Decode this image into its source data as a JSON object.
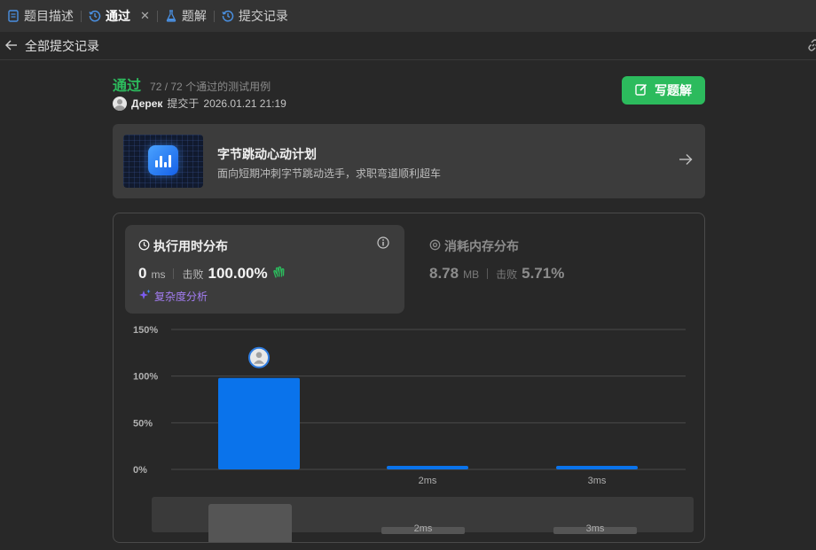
{
  "tabs": [
    {
      "label": "题目描述",
      "icon": "document-icon",
      "active": false
    },
    {
      "label": "通过",
      "icon": "history-icon",
      "active": true
    },
    {
      "label": "题解",
      "icon": "flask-icon",
      "active": false
    },
    {
      "label": "提交记录",
      "icon": "history-icon",
      "active": false
    }
  ],
  "subheader": {
    "back_label": "全部提交记录"
  },
  "submission": {
    "status": "通过",
    "tests_passed": "72 / 72",
    "tests_label": "个通过的测试用例",
    "user": "Дерек",
    "submitted_prefix": "提交于",
    "timestamp": "2026.01.21 21:19",
    "write_solution_label": "写题解"
  },
  "banner": {
    "title": "字节跳动心动计划",
    "subtitle": "面向短期冲刺字节跳动选手，求职弯道顺利超车"
  },
  "runtime": {
    "title": "执行用时分布",
    "value": "0",
    "unit": "ms",
    "beats_label": "击败",
    "beats": "100.00%",
    "complexity_label": "复杂度分析"
  },
  "memory": {
    "title": "消耗内存分布",
    "value": "8.78",
    "unit": "MB",
    "beats_label": "击败",
    "beats": "5.71%"
  },
  "colors": {
    "accent_green": "#2cbb5d",
    "bar_blue": "#0a73eb",
    "purple": "#a37df2"
  },
  "chart_data": {
    "type": "bar",
    "categories": [
      "0ms",
      "2ms",
      "3ms"
    ],
    "values": [
      98,
      3,
      3
    ],
    "visible_x_labels": [
      "",
      "2ms",
      "3ms"
    ],
    "y_ticks": [
      "150%",
      "100%",
      "50%",
      "0%"
    ],
    "ylim": [
      0,
      150
    ],
    "highlight_index": 0,
    "overview": {
      "labels": [
        "",
        "2ms",
        "3ms"
      ]
    }
  }
}
